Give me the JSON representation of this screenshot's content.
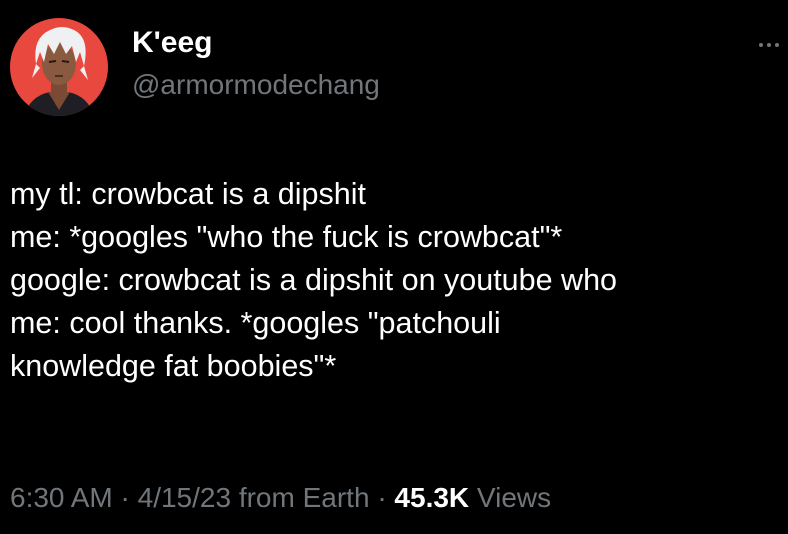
{
  "author": {
    "display_name": "K'eeg",
    "handle": "@armormodechang"
  },
  "tweet": {
    "lines": [
      "my tl: crowbcat is a dipshit",
      "me: *googles \"who the fuck is crowbcat\"*",
      "google: crowbcat is a dipshit on youtube who",
      "me: cool thanks. *googles \"patchouli",
      "knowledge fat boobies\"*"
    ]
  },
  "meta": {
    "time": "6:30 AM",
    "separator": "·",
    "date": "4/15/23",
    "source": "from Earth",
    "views_count": "45.3K",
    "views_label": "Views"
  },
  "icons": {
    "more": "more-dots-icon",
    "avatar": "avatar"
  },
  "colors": {
    "background": "#000000",
    "text_primary": "#ffffff",
    "text_secondary": "#71767b",
    "avatar_bg": "#e8483d"
  }
}
